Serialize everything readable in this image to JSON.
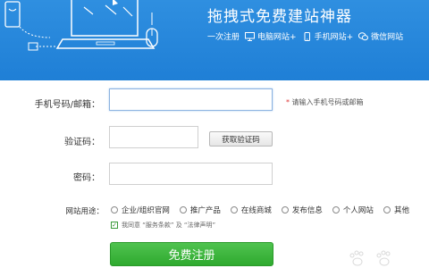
{
  "banner": {
    "title": "拖拽式免费建站神器",
    "features": [
      {
        "icon": "monitor-icon",
        "label": "一次注册"
      },
      {
        "icon": "monitor-icon",
        "label": "电脑网站+"
      },
      {
        "icon": "phone-icon",
        "label": "手机网站+"
      },
      {
        "icon": "wechat-icon",
        "label": "微信网站"
      }
    ],
    "bg_color": "#2f8fe0"
  },
  "form": {
    "phone_label": "手机号码/邮箱：",
    "phone_value": "",
    "phone_hint_star": "*",
    "phone_hint": "请输入手机号码或邮箱",
    "code_label": "验证码：",
    "code_value": "",
    "get_code_button": "获取验证码",
    "password_label": "密码：",
    "password_value": "",
    "usage_label": "网站用途：",
    "usage_options": [
      "企业/组织官网",
      "推广产品",
      "在线商城",
      "发布信息",
      "个人网站",
      "其他"
    ],
    "agree_checked": true,
    "agree_text": "我同意 “服务条款” 及 “法律声明”",
    "submit_label": "免费注册",
    "submit_color": "#3cb53c"
  }
}
